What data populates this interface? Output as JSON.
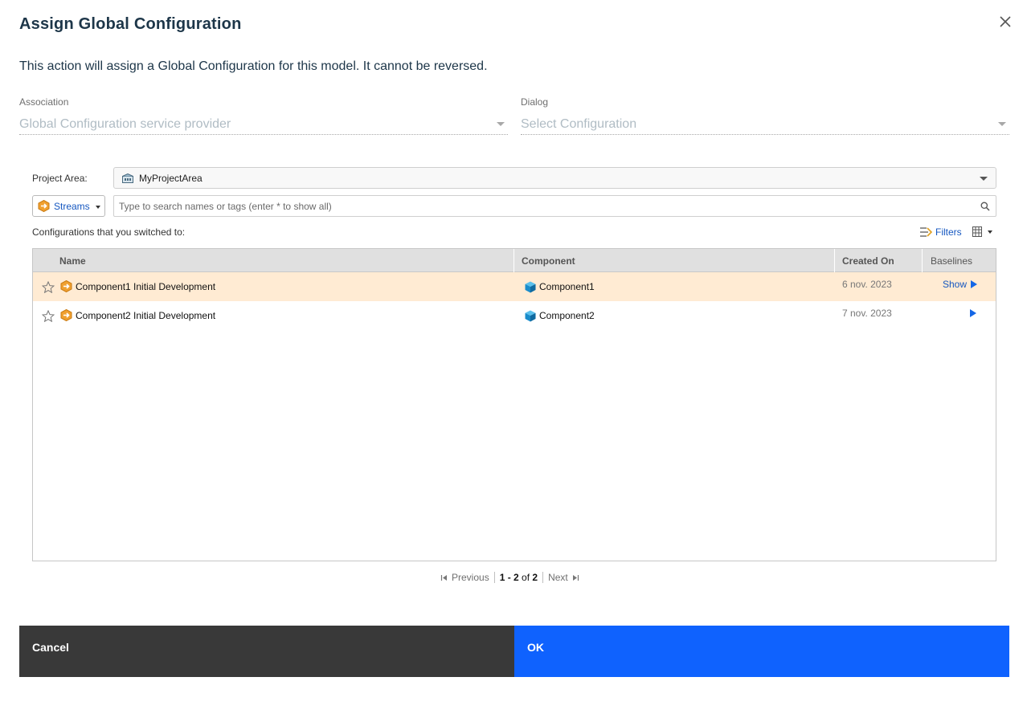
{
  "dialog": {
    "title": "Assign Global Configuration",
    "description": "This action will assign a Global Configuration for this model. It cannot be reversed."
  },
  "association": {
    "label": "Association",
    "value": "Global Configuration service provider"
  },
  "dialog_field": {
    "label": "Dialog",
    "value": "Select Configuration"
  },
  "project_area": {
    "label": "Project Area:",
    "value": "MyProjectArea",
    "icon": "project-area-icon"
  },
  "streams": {
    "label": "Streams",
    "icon": "stream-icon"
  },
  "search": {
    "placeholder": "Type to search names or tags (enter * to show all)",
    "value": ""
  },
  "switched_label": "Configurations that you switched to:",
  "toolbar": {
    "filters_label": "Filters"
  },
  "table": {
    "columns": [
      "Name",
      "Component",
      "Created On",
      "Baselines"
    ],
    "rows": [
      {
        "name": "Component1 Initial Development",
        "component": "Component1",
        "created_on": "6 nov. 2023",
        "baselines": "Show",
        "selected": true
      },
      {
        "name": "Component2 Initial Development",
        "component": "Component2",
        "created_on": "7 nov. 2023",
        "baselines": "",
        "selected": false
      }
    ]
  },
  "pager": {
    "previous": "Previous",
    "range": "1 - 2",
    "of": "of",
    "total": "2",
    "next": "Next"
  },
  "buttons": {
    "cancel": "Cancel",
    "ok": "OK"
  },
  "colors": {
    "primary": "#0f62fe",
    "secondary": "#393939",
    "selected_row": "#ffebd3",
    "stream_orange": "#f0a030",
    "component_blue": "#1a8ccb"
  }
}
